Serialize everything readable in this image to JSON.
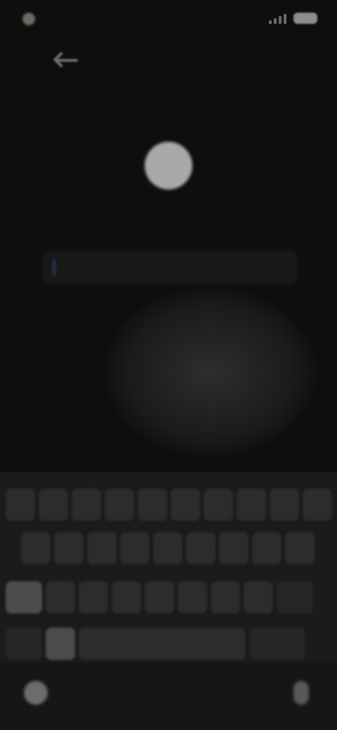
{
  "status_bar": {
    "time": "",
    "battery": ""
  },
  "header": {
    "prompt_title": "",
    "input_placeholder": ""
  },
  "keyboard": {
    "row1": [
      "",
      "",
      "",
      "",
      "",
      "",
      "",
      "",
      "",
      ""
    ],
    "row2": [
      "",
      "",
      "",
      "",
      "",
      "",
      "",
      "",
      ""
    ],
    "row3": [
      "",
      "",
      "",
      "",
      "",
      "",
      "",
      "",
      ""
    ],
    "row4": {
      "symbols": "",
      "emoji": "",
      "space": "",
      "next": ""
    }
  },
  "colors": {
    "background": "#0e0e0e",
    "keyboard": "#1b1b1b",
    "key": "#2c2c2c"
  }
}
